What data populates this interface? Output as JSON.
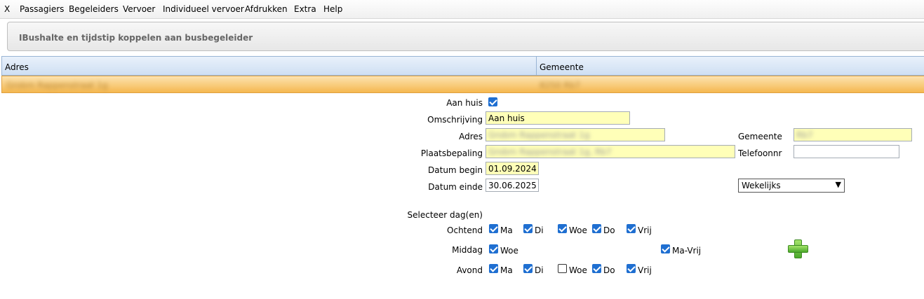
{
  "menu": [
    "X",
    "Passagiers",
    "Begeleiders",
    "Vervoer",
    "Individueel vervoer",
    "Afdrukken",
    "Extra",
    "Help"
  ],
  "panel_title": "IBushalte en tijdstip koppelen aan busbegeleider",
  "grid": {
    "columns": [
      "Adres",
      "Gemeente"
    ],
    "selected_row": [
      "Grobm Rappenstraat 1g",
      "8250 Rb7"
    ]
  },
  "form": {
    "aan_huis_label": "Aan huis",
    "aan_huis_checked": true,
    "omschrijving_label": "Omschrijving",
    "omschrijving_value": "Aan huis",
    "adres_label": "Adres",
    "adres_value": "Grobm Rappenstraat 1g",
    "gemeente_label": "Gemeente",
    "gemeente_value": "Rb7",
    "plaatsbepaling_label": "Plaatsbepaling",
    "plaatsbepaling_value": "Grobm Rappenstraat 1g, Rb7",
    "telefoonnr_label": "Telefoonnr",
    "telefoonnr_value": "",
    "datum_begin_label": "Datum begin",
    "datum_begin_value": "01.09.2024",
    "datum_einde_label": "Datum einde",
    "datum_einde_value": "30.06.2025",
    "frequentie_value": "Wekelijks",
    "selecteer_label": "Selecteer dag(en)",
    "ochtend_label": "Ochtend",
    "middag_label": "Middag",
    "avond_label": "Avond",
    "ochtend": [
      {
        "day": "Ma",
        "checked": true
      },
      {
        "day": "Di",
        "checked": true
      },
      {
        "day": "Woe",
        "checked": true
      },
      {
        "day": "Do",
        "checked": true
      },
      {
        "day": "Vrij",
        "checked": true
      }
    ],
    "middag": [
      {
        "day": "Woe",
        "checked": true
      },
      {
        "day": "Ma-Vrij",
        "checked": true
      }
    ],
    "avond": [
      {
        "day": "Ma",
        "checked": true
      },
      {
        "day": "Di",
        "checked": true
      },
      {
        "day": "Woe",
        "checked": false
      },
      {
        "day": "Do",
        "checked": true
      },
      {
        "day": "Vrij",
        "checked": true
      }
    ]
  },
  "add_icon": "plus-icon",
  "colors": {
    "selected_row": "#f5b850",
    "required_field": "#ffffb8",
    "checkbox": "#1f6fd1"
  }
}
